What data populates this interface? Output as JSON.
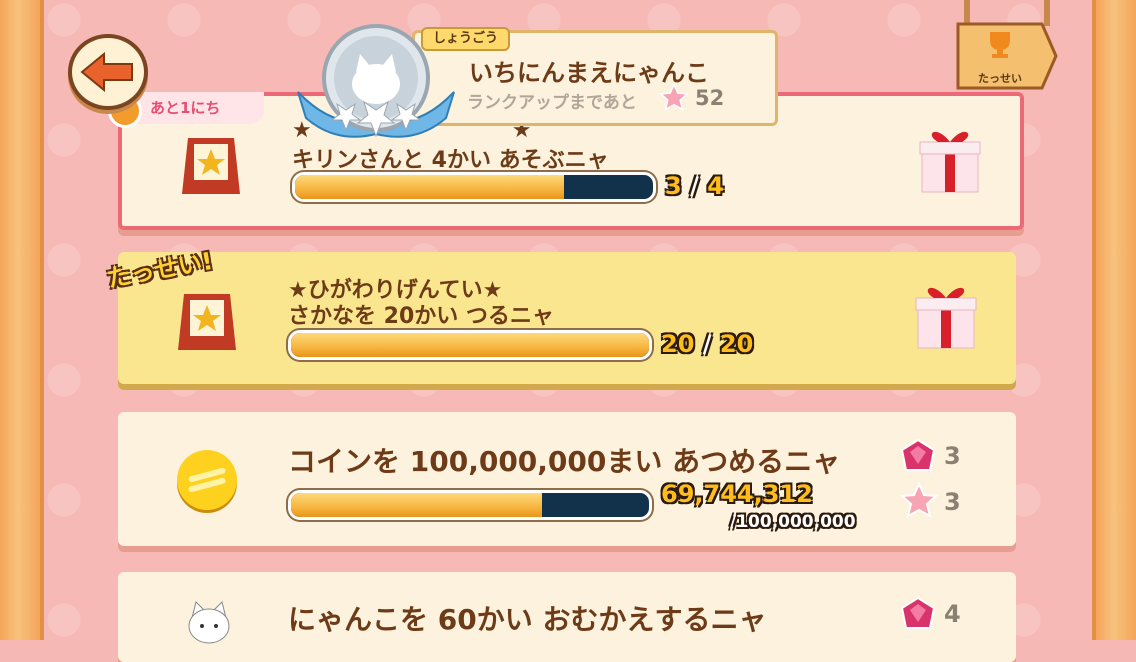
{
  "header": {
    "title_label": "しょうごう",
    "title": "いちにんまえにゃんこ",
    "next_rank_text": "ランクアップまであと",
    "next_rank_value": "52",
    "achievements_label": "たっせい"
  },
  "missions": [
    {
      "badge": "あと1にち",
      "title_line1": "★",
      "title_line1_tail": "★",
      "title_line2": "キリンさんと 4かい あそぶニャ",
      "current": "3",
      "sep": "/",
      "goal": "4",
      "progress": 0.75
    },
    {
      "badge": "たっせい!",
      "title_line1": "★ひがわりげんてい★",
      "title_line2": "さかなを 20かい つるニャ",
      "current": "20",
      "sep": "/",
      "goal": "20",
      "progress": 1.0
    },
    {
      "title": "コインを 100,000,000まい あつめるニャ",
      "current": "69,744,312",
      "goal_line": "/100,000,000",
      "progress": 0.7,
      "rewards": [
        {
          "icon": "gem-icon",
          "value": "3"
        },
        {
          "icon": "star-icon",
          "value": "3"
        }
      ]
    },
    {
      "title": "にゃんこを 60かい おむかえするニャ",
      "rewards": [
        {
          "icon": "gem-icon",
          "value": "4"
        }
      ]
    }
  ],
  "colors": {
    "background": "#f7b9b5",
    "card": "#fdf2dd",
    "card_completed": "#fbe690",
    "progress_fill": "#f6b53e",
    "progress_empty": "#12324b",
    "count_text": "#ffbd1c"
  }
}
